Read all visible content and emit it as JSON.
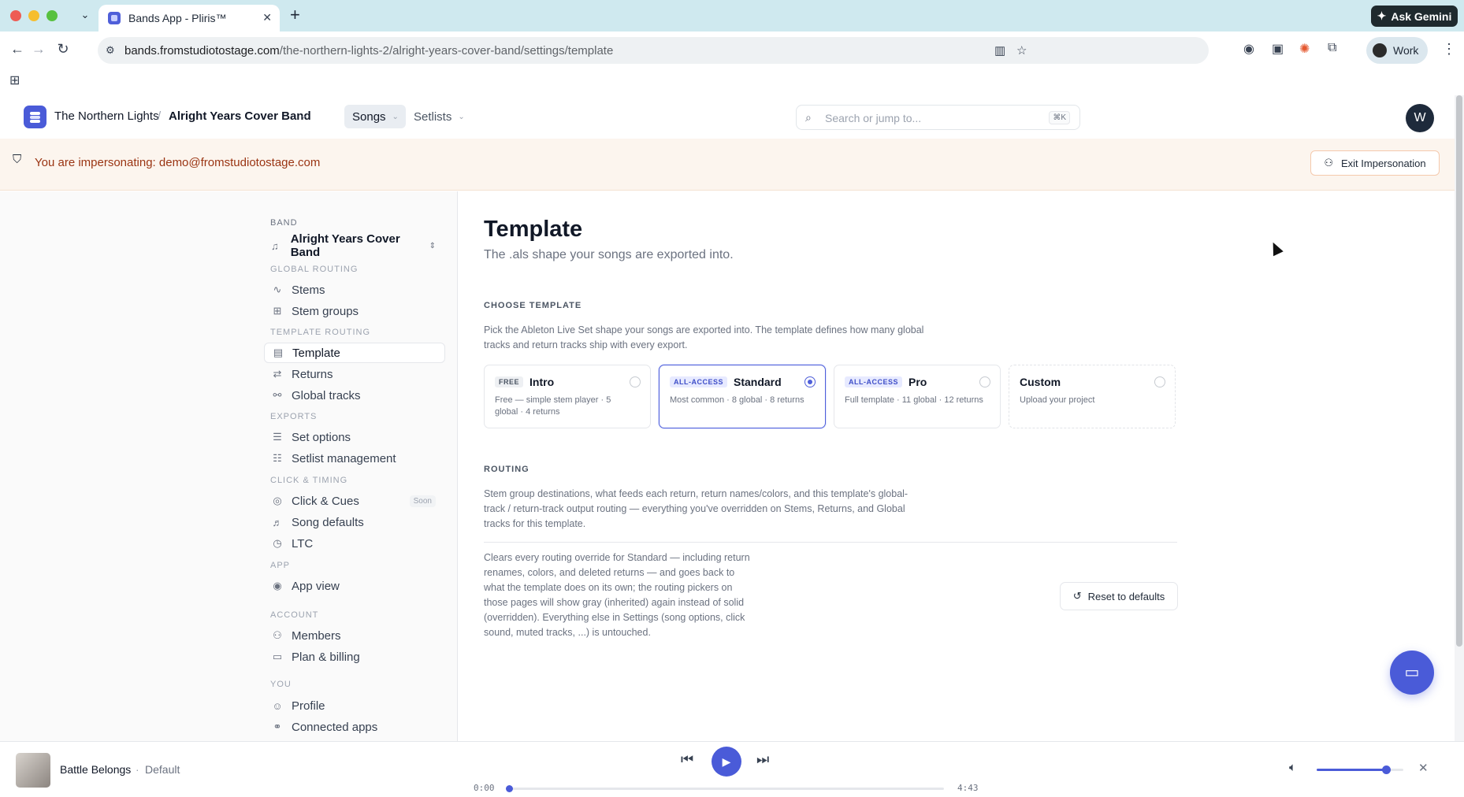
{
  "browser": {
    "tab_title": "Bands App - Pliris™",
    "tab_close": "✕",
    "new_tab": "+",
    "ask_gemini": "Ask Gemini",
    "url_host": "bands.fromstudiotostage.com",
    "url_path": "/the-northern-lights-2/alright-years-cover-band/settings/template",
    "profile_label": "Work"
  },
  "header": {
    "org": "The Northern Lights",
    "separator": "/",
    "band": "Alright Years Cover Band",
    "menu_songs": "Songs",
    "menu_setlists": "Setlists",
    "search_placeholder": "Search or jump to...",
    "search_shortcut": "⌘K",
    "user_initial": "W"
  },
  "impersonation": {
    "message": "You are impersonating: demo@fromstudiotostage.com",
    "exit_label": "Exit Impersonation"
  },
  "sidebar": {
    "band_section": "BAND",
    "band_name": "Alright Years Cover Band",
    "global_routing": "GLOBAL ROUTING",
    "stems": "Stems",
    "stem_groups": "Stem groups",
    "template_routing": "TEMPLATE ROUTING",
    "template": "Template",
    "returns": "Returns",
    "global_tracks": "Global tracks",
    "exports": "EXPORTS",
    "set_options": "Set options",
    "setlist_management": "Setlist management",
    "click_timing": "CLICK & TIMING",
    "click_cues": "Click & Cues",
    "soon_badge": "Soon",
    "song_defaults": "Song defaults",
    "ltc": "LTC",
    "app": "APP",
    "app_view": "App view",
    "account": "ACCOUNT",
    "members": "Members",
    "plan_billing": "Plan & billing",
    "you": "YOU",
    "profile": "Profile",
    "connected_apps": "Connected apps"
  },
  "main": {
    "title": "Template",
    "subtitle": "The .als shape your songs are exported into.",
    "choose_heading": "CHOOSE TEMPLATE",
    "choose_desc_1": "Pick the Ableton Live Set shape your songs are exported into. The template defines how many global",
    "choose_desc_2": "tracks and return tracks ship with every export.",
    "templates": [
      {
        "badge": "FREE",
        "name": "Intro",
        "desc": "Free — simple stem player · 5 global · 4 returns",
        "selected": false
      },
      {
        "badge": "ALL-ACCESS",
        "name": "Standard",
        "desc": "Most common · 8 global · 8 returns",
        "selected": true
      },
      {
        "badge": "ALL-ACCESS",
        "name": "Pro",
        "desc": "Full template · 11 global · 12 returns",
        "selected": false
      },
      {
        "badge": "",
        "name": "Custom",
        "desc": "Upload your project",
        "selected": false
      }
    ],
    "routing_heading": "ROUTING",
    "routing_desc_1": "Stem group destinations, what feeds each return, return names/colors, and this template's global-",
    "routing_desc_2": "track / return-track output routing — everything you've overridden on Stems, Returns, and Global",
    "routing_desc_3": "tracks for this template.",
    "reset_desc_1": "Clears every routing override for Standard — including return",
    "reset_desc_2": "renames, colors, and deleted returns — and goes back to",
    "reset_desc_3": "what the template does on its own; the routing pickers on",
    "reset_desc_4": "those pages will show gray (inherited) again instead of solid",
    "reset_desc_5": "(overridden). Everything else in Settings (song options, click",
    "reset_desc_6": "sound, muted tracks, ...) is untouched.",
    "reset_label": "Reset to defaults"
  },
  "player": {
    "song": "Battle Belongs",
    "dot": "·",
    "variant": "Default",
    "time_current": "0:00",
    "time_total": "4:43",
    "progress_fraction": 0.0,
    "volume_fraction": 0.8
  },
  "colors": {
    "accent": "#4a5bd8",
    "banner_bg": "#fcf5ee",
    "banner_text": "#9a3412"
  }
}
